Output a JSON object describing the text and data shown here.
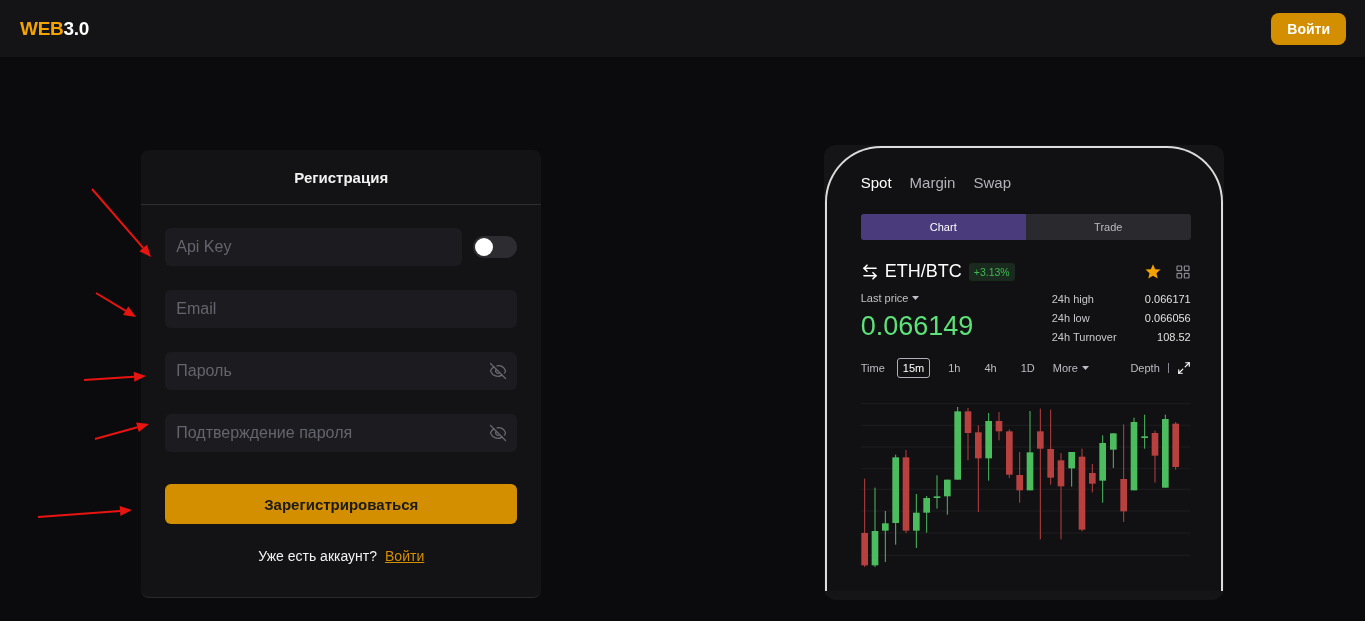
{
  "header": {
    "logo": {
      "accent": "WEB",
      "rest": "3.0"
    },
    "login_button": "Войти"
  },
  "registration": {
    "title": "Регистрация",
    "fields": [
      {
        "kind": "toggle",
        "placeholder": "Api Key",
        "toggle_on": false
      },
      {
        "kind": "text",
        "placeholder": "Email"
      },
      {
        "kind": "password",
        "placeholder": "Пароль"
      },
      {
        "kind": "password",
        "placeholder": "Подтверждение пароля"
      }
    ],
    "submit_button": "Зарегистрироваться",
    "login_prompt": "Уже есть аккаунт?",
    "login_link": "Войти"
  },
  "phone": {
    "market_tabs": [
      {
        "label": "Spot",
        "selected": true
      },
      {
        "label": "Margin",
        "selected": false
      },
      {
        "label": "Swap",
        "selected": false
      }
    ],
    "view_tabs": [
      {
        "label": "Chart",
        "selected": true
      },
      {
        "label": "Trade",
        "selected": false
      }
    ],
    "pair": "ETH/BTC",
    "change": "+3.13%",
    "favorite": true,
    "last_price_label": "Last price",
    "last_price": "0.066149",
    "stats": [
      {
        "label": "24h high",
        "value": "0.066171"
      },
      {
        "label": "24h low",
        "value": "0.066056"
      },
      {
        "label": "24h Turnover",
        "value": "108.52"
      }
    ],
    "time_label": "Time",
    "intervals": [
      {
        "label": "15m",
        "selected": true
      },
      {
        "label": "1h",
        "selected": false
      },
      {
        "label": "4h",
        "selected": false
      },
      {
        "label": "1D",
        "selected": false
      }
    ],
    "more": "More",
    "depth": "Depth"
  }
}
